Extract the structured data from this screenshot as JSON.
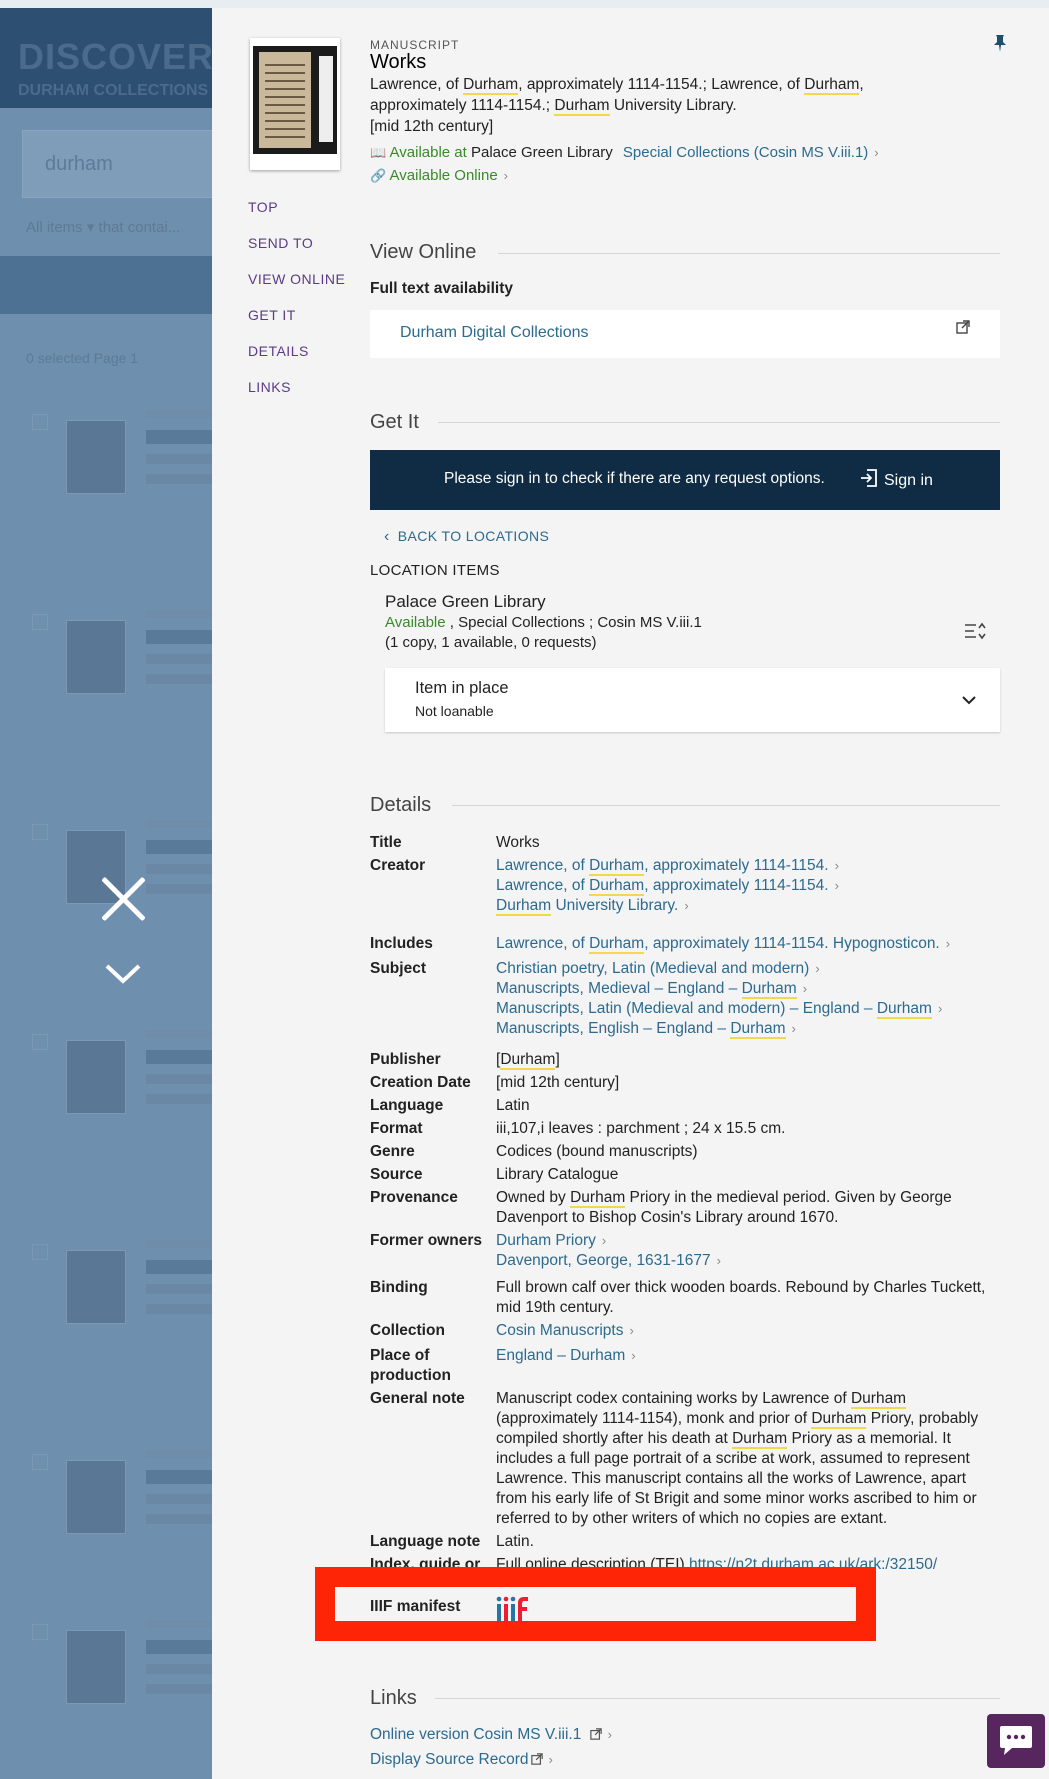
{
  "background": {
    "logo_line1": "DISCOVER",
    "logo_line2": "DURHAM COLLECTIONS",
    "search_value": "durham",
    "filter_text": "All items ▾      that contai...",
    "selected_text": "0 selected   Page 1"
  },
  "record": {
    "type": "MANUSCRIPT",
    "title": "Works",
    "creator_parts": [
      "Lawrence, of ",
      "Durham",
      ", approximately 1114-1154.; Lawrence, of ",
      "Durham",
      ","
    ],
    "creator_line2_a": "approximately 1114-1154.; ",
    "creator_line2_b": "Durham",
    "creator_line2_c": " University Library.",
    "date": "[mid 12th century]",
    "available_at": "Available at",
    "library": "Palace Green Library",
    "location_link": "Special Collections (Cosin MS V.iii.1)",
    "available_online": "Available Online"
  },
  "side_nav": [
    "TOP",
    "SEND TO",
    "VIEW ONLINE",
    "GET IT",
    "DETAILS",
    "LINKS"
  ],
  "view_online": {
    "heading": "View Online",
    "subheading": "Full text availability",
    "link": "Durham Digital Collections"
  },
  "get_it": {
    "heading": "Get It",
    "signin_message": "Please sign in to check if there are any request options.",
    "signin_button": "Sign in",
    "back": "BACK TO LOCATIONS",
    "location_items": "LOCATION ITEMS",
    "library": "Palace Green Library",
    "status": "Available",
    "status_rest": " , Special Collections ; Cosin MS V.iii.1",
    "copies": "(1 copy, 1 available, 0 requests)",
    "item_title": "Item in place",
    "item_sub": "Not loanable"
  },
  "details": {
    "heading": "Details",
    "labels": {
      "title": "Title",
      "creator": "Creator",
      "includes": "Includes",
      "subject": "Subject",
      "publisher": "Publisher",
      "creation_date": "Creation Date",
      "language": "Language",
      "format": "Format",
      "genre": "Genre",
      "source": "Source",
      "provenance": "Provenance",
      "former_owners": "Former owners",
      "binding": "Binding",
      "collection": "Collection",
      "place_1": "Place of",
      "place_2": "production",
      "general_note": "General note",
      "language_note": "Language note",
      "index_guide": "Index, guide or",
      "iiif": "IIIF manifest"
    },
    "title": "Works",
    "creator_1a": "Lawrence, of ",
    "creator_1b": "Durham",
    "creator_1c": ", approximately 1114-1154.",
    "creator_2a": "Lawrence, of ",
    "creator_2b": "Durham",
    "creator_2c": ", approximately 1114-1154.",
    "creator_3a": "Durham",
    "creator_3b": " University Library.",
    "includes_a": "Lawrence, of ",
    "includes_b": "Durham",
    "includes_c": ", approximately 1114-1154. Hypognosticon.",
    "subject_1": "Christian poetry, Latin (Medieval and modern)",
    "subject_2a": "Manuscripts, Medieval – England – ",
    "subject_2b": "Durham",
    "subject_3a": "Manuscripts, Latin (Medieval and modern) – England – ",
    "subject_3b": "Durham",
    "subject_4a": "Manuscripts, English – England – ",
    "subject_4b": "Durham",
    "publisher_a": "[",
    "publisher_b": "Durham",
    "publisher_c": "]",
    "creation_date": "[mid 12th century]",
    "language": "Latin",
    "format": "iii,107,i leaves : parchment ; 24 x 15.5 cm.",
    "genre": "Codices (bound manuscripts)",
    "source": "Library Catalogue",
    "provenance_a": "Owned by ",
    "provenance_b": "Durham",
    "provenance_c": " Priory in the medieval period. Given by George Davenport to Bishop Cosin's Library around 1670.",
    "former_1": "Durham Priory",
    "former_2": "Davenport, George, 1631-1677",
    "binding": "Full brown calf over thick wooden boards. Rebound by Charles Tuckett, mid 19th century.",
    "collection": "Cosin Manuscripts",
    "place": "England – Durham",
    "note_1": "Manuscript codex containing works by Lawrence of ",
    "note_2": "Durham",
    "note_3": " (approximately 1114-1154), monk and prior of ",
    "note_4": "Durham",
    "note_5": " Priory, probably compiled shortly after his death at ",
    "note_6": "Durham",
    "note_7": " Priory as a memorial. It includes a full page portrait of a scribe at work, assumed to represent Lawrence. This manuscript contains all the works of Lawrence, apart from his early life of St Brigit and some minor works ascribed to him or referred to by other writers of which no copies are extant.",
    "language_note": "Latin.",
    "index_a": "Full online description (TEI) ",
    "index_b": "https://n2t.",
    "index_c": "durham",
    "index_d": ".ac.uk/ark:/32150/"
  },
  "links": {
    "heading": "Links",
    "link_1": "Online version Cosin MS V.iii.1",
    "link_2": "Display Source Record"
  },
  "colors": {
    "panel_bg": "#f4f4f4",
    "overlay": "#5f7f9e",
    "signin_bar": "#0f2c44",
    "link": "#2c6a8e",
    "available_green": "#3a8a2a",
    "highlight_frame": "#fe2406",
    "chat": "#57265f"
  },
  "icons": [
    "close-icon",
    "chevron-down-icon",
    "pin-icon",
    "book-icon",
    "link-icon",
    "external-link-icon",
    "sign-in-icon",
    "chevron-left-icon",
    "sort-list-icon",
    "iiif-logo-icon",
    "chat-icon"
  ]
}
